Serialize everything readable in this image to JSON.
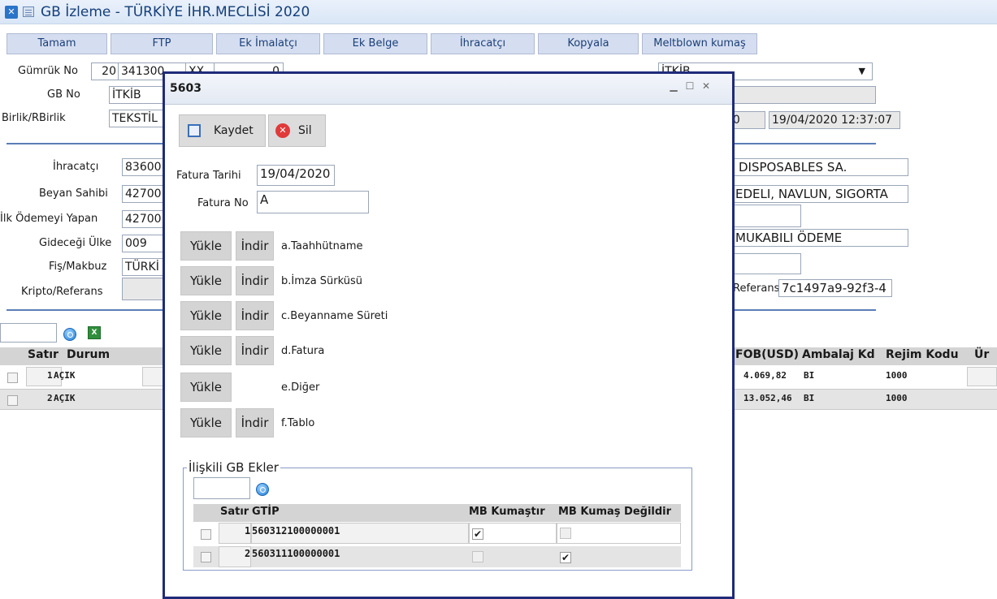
{
  "window": {
    "title": "GB İzleme - TÜRKİYE İHR.MECLİSİ 2020"
  },
  "toolbar": [
    "Tamam",
    "FTP",
    "Ek İmalatçı",
    "Ek Belge",
    "İhracatçı",
    "Kopyala",
    "Meltblown kumaş"
  ],
  "form": {
    "gumruk_no_label": "Gümrük No",
    "gumruk_no_a": "20",
    "gumruk_no_b": "341300",
    "gumruk_no_c": "XX",
    "gumruk_no_d": "0",
    "gb_no_label": "GB No",
    "gb_no_value": "İTKİB",
    "birlik_label": "Birlik/RBirlik",
    "birlik_value": "TEKSTİL",
    "right_dropdown": "İTKİB",
    "right_field_a": "000",
    "right_field_date": "19/04/2020 12:37:07",
    "ihracatci_label": "İhracatçı",
    "ihracatci_value": "83600",
    "beyan_label": "Beyan Sahibi",
    "beyan_value": "42700",
    "ilk_odeme_label": "İlk Ödemeyi Yapan",
    "ilk_odeme_value": "42700",
    "gidecegi_label": "Gideceği Ülke",
    "gidecegi_value": "009",
    "fis_label": "Fiş/Makbuz",
    "fis_value": "TÜRKİ",
    "kripto_label": "Kripto/Referans",
    "right_company": "DISPOSABLES SA.",
    "right_terms": "EDELI, NAVLUN, SIGORTA",
    "right_payment": "MUKABILI ÖDEME",
    "referans_label": "Referans",
    "referans_value": "7c1497a9-92f3-4"
  },
  "grid": {
    "headers": [
      "Satır",
      "Durum",
      "FOB(USD)",
      "Ambalaj Kd",
      "Rejim Kodu",
      "Ür"
    ],
    "rows": [
      {
        "satir": "1",
        "durum": "AÇIK",
        "fob": "4.069,82",
        "ambalaj": "BI",
        "rejim": "1000"
      },
      {
        "satir": "2",
        "durum": "AÇIK",
        "fob": "13.052,46",
        "ambalaj": "BI",
        "rejim": "1000"
      }
    ]
  },
  "dialog": {
    "title": "5603",
    "save_label": "Kaydet",
    "delete_label": "Sil",
    "fatura_tarihi_label": "Fatura Tarihi",
    "fatura_tarihi_value": "19/04/2020",
    "fatura_no_label": "Fatura No",
    "fatura_no_value": "A",
    "upload_label": "Yükle",
    "download_label": "İndir",
    "docs": [
      "a.Taahhütname",
      "b.İmza Sürküsü",
      "c.Beyanname Süreti",
      "d.Fatura",
      "e.Diğer",
      "f.Tablo"
    ],
    "related_title": "İlişkili GB Ekler",
    "related_headers": [
      "Satır",
      "GTİP",
      "MB Kumaştır",
      "MB Kumaş Değildir"
    ],
    "related_rows": [
      {
        "satir": "1",
        "gtip": "560312100000001",
        "mb_kumas": true,
        "mb_degil": false
      },
      {
        "satir": "2",
        "gtip": "560311100000001",
        "mb_kumas": false,
        "mb_degil": true
      }
    ]
  }
}
